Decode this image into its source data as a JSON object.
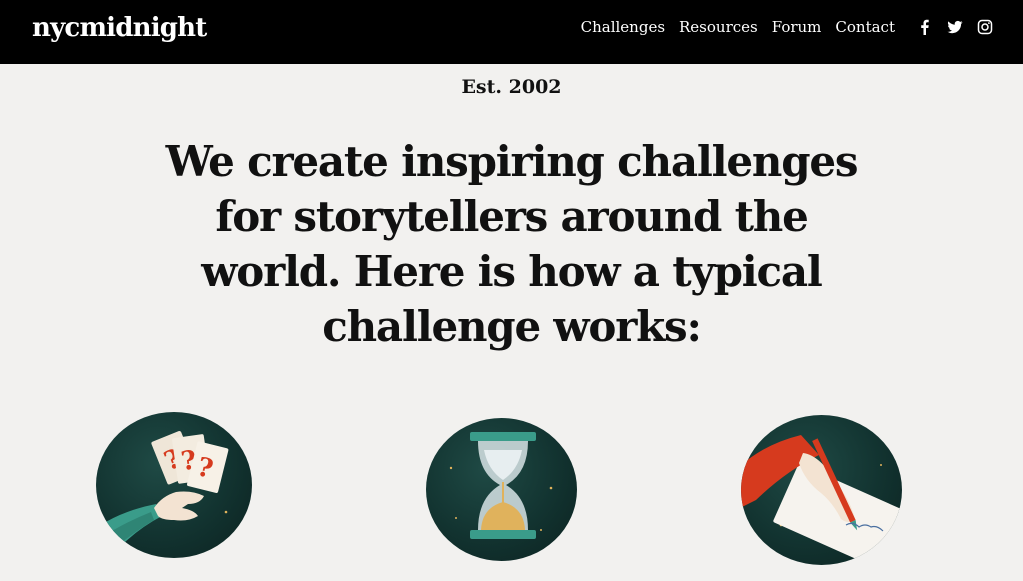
{
  "header": {
    "logo": "nycmidnight",
    "nav": [
      {
        "label": "Challenges"
      },
      {
        "label": "Resources"
      },
      {
        "label": "Forum"
      },
      {
        "label": "Contact"
      }
    ],
    "social": [
      {
        "icon": "facebook-icon"
      },
      {
        "icon": "twitter-icon"
      },
      {
        "icon": "instagram-icon"
      }
    ]
  },
  "hero": {
    "established": "Est. 2002",
    "headline": "We create inspiring challenges for storytellers around the world. Here is how a typical challenge works:"
  },
  "illustrations": [
    {
      "icon": "cards-question-illustration"
    },
    {
      "icon": "hourglass-illustration"
    },
    {
      "icon": "writing-hand-illustration"
    }
  ],
  "colors": {
    "navbar": "#000000",
    "background": "#f2f1ef",
    "illustration_bg": "#123330",
    "accent_red": "#d63a1e",
    "accent_teal": "#3a9c8a",
    "sand": "#e0b25c"
  }
}
